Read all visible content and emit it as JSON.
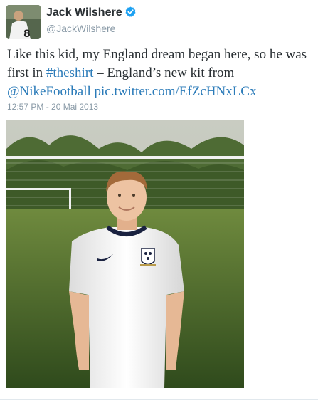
{
  "user": {
    "name": "Jack Wilshere",
    "handle": "@JackWilshere",
    "verified_icon": "verified-badge-icon"
  },
  "tweet": {
    "text_part1": "Like this kid, my England dream began here, so he was first in ",
    "hashtag": "#theshirt",
    "text_part2": " – England’s new kit from ",
    "mention": "@NikeFootball",
    "space": " ",
    "pic_link": "pic.twitter.com/EfZcHNxLCx",
    "timestamp": "12:57 PM - 20 Mai 2013"
  },
  "colors": {
    "link": "#2b7bb9",
    "name": "#292f33",
    "meta": "#8899a6",
    "verified": "#1da1f2"
  }
}
